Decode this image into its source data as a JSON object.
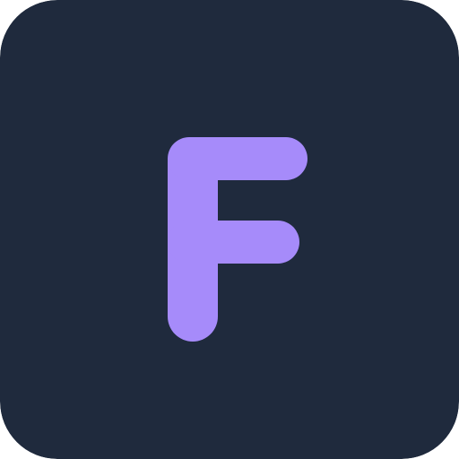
{
  "icon": {
    "letter": "F",
    "name": "letter-f-icon",
    "colors": {
      "background": "#1F2A3D",
      "glyph": "#A68BFA"
    }
  }
}
